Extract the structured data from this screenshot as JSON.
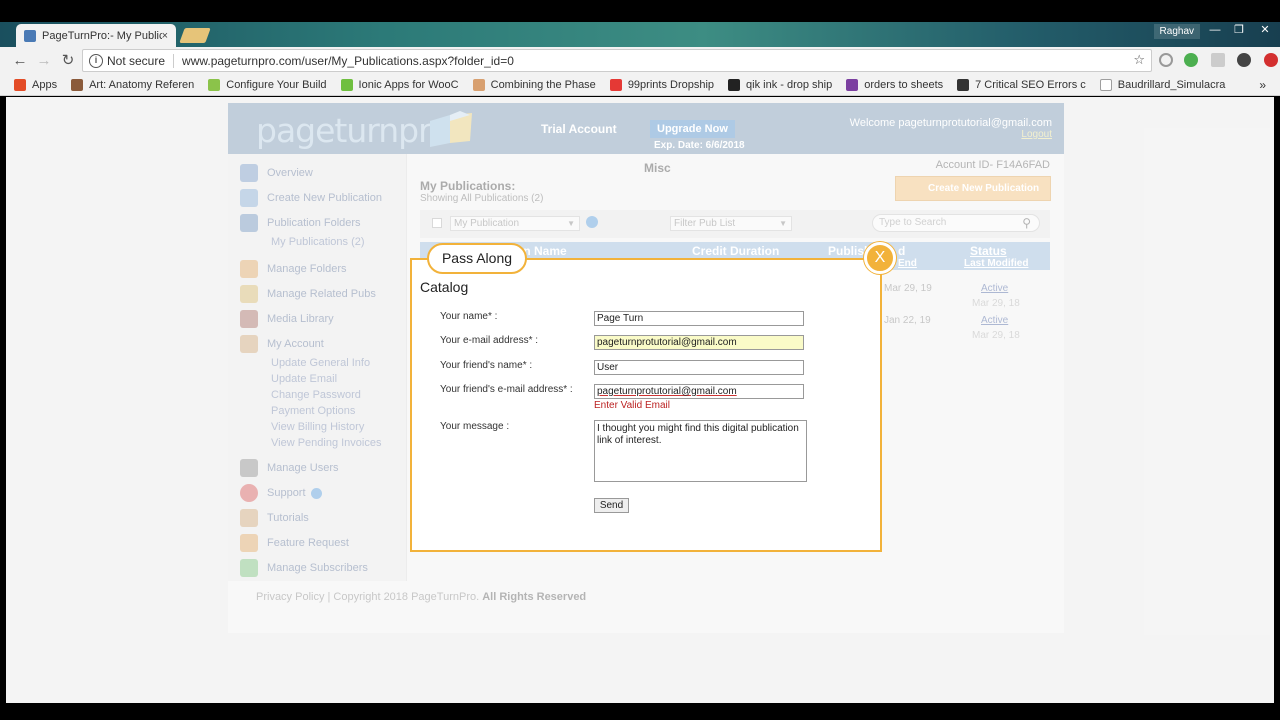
{
  "browser": {
    "tab_title": "PageTurnPro:- My Public",
    "tab_close": "×",
    "profile": "Raghav",
    "security": "Not secure",
    "url": "www.pageturnpro.com/user/My_Publications.aspx?folder_id=0",
    "bookmarks": [
      {
        "label": "Apps",
        "icon": "apps-icon",
        "color": "#e34c26"
      },
      {
        "label": "Art: Anatomy Referen",
        "icon": "figure-icon",
        "color": "#8a5a3a"
      },
      {
        "label": "Configure Your Build",
        "icon": "android-icon",
        "color": "#8bc34a"
      },
      {
        "label": "Ionic Apps for WooC",
        "icon": "ionic-icon",
        "color": "#6fbf3f"
      },
      {
        "label": "Combining the Phase",
        "icon": "person-icon",
        "color": "#d8a070"
      },
      {
        "label": "99prints Dropship",
        "icon": "gift-icon",
        "color": "#e53935"
      },
      {
        "label": "qik ink - drop ship",
        "icon": "qik-icon",
        "color": "#222222"
      },
      {
        "label": "orders to sheets",
        "icon": "woo-icon",
        "color": "#7b3fa0"
      },
      {
        "label": "7 Critical SEO Errors c",
        "icon": "chart-icon",
        "color": "#333333"
      },
      {
        "label": "Baudrillard_Simulacra",
        "icon": "doc-icon",
        "color": "#9e9e9e"
      }
    ],
    "bookmarks_more": "»"
  },
  "header": {
    "logo": "pageturnpro",
    "trial": "Trial Account",
    "upgrade": "Upgrade Now",
    "exp": "Exp. Date: 6/6/2018",
    "welcome": "Welcome pageturnprotutorial@gmail.com",
    "logout": "Logout"
  },
  "sidebar": {
    "items": [
      {
        "label": "Overview",
        "color": "#4a7ab5"
      },
      {
        "label": "Create New Publication",
        "color": "#5b8fc7"
      },
      {
        "label": "Publication Folders",
        "color": "#3d6fa8"
      },
      {
        "label": "Manage Folders",
        "color": "#d68a2e"
      },
      {
        "label": "Manage Related Pubs",
        "color": "#c9a43a"
      },
      {
        "label": "Media Library",
        "color": "#8a3b2e"
      },
      {
        "label": "My Account",
        "color": "#c08a4a"
      },
      {
        "label": "Manage Users",
        "color": "#666666"
      },
      {
        "label": "Support",
        "color": "#cc2222"
      },
      {
        "label": "Tutorials",
        "color": "#c08a4a"
      },
      {
        "label": "Feature Request",
        "color": "#d68a2e"
      },
      {
        "label": "Manage Subscribers",
        "color": "#4caf50"
      }
    ],
    "folder_sub": "My Publications (2)",
    "account_subs": [
      "Update General Info",
      "Update Email",
      "Change Password",
      "Payment Options",
      "View Billing History",
      "View Pending Invoices"
    ]
  },
  "main": {
    "misc": "Misc",
    "account_id": "Account ID- F14A6FAD",
    "title": "My Publications:",
    "showing": "Showing All Publications (2)",
    "create_btn": "Create New Publication",
    "pub_select": "My Publication",
    "filter_select": "Filter Pub List",
    "search_placeholder": "Type to Search",
    "col_name": "on Name",
    "col_credit": "Credit Duration",
    "col_publish": "Publish",
    "col_end_suffix": "d",
    "col_end": "End",
    "col_status": "Status",
    "col_last": "Last Modified",
    "rows": [
      {
        "end": "Mar 29, 19",
        "status": "Active",
        "modified": "Mar 29, 18"
      },
      {
        "end": "Jan 22, 19",
        "status": "Active",
        "modified": "Mar 29, 18"
      }
    ]
  },
  "footer": {
    "text": "Privacy Policy | Copyright 2018 PageTurnPro.",
    "bold": "All Rights Reserved"
  },
  "dialog": {
    "tab": "Pass Along",
    "close": "X",
    "title": "Catalog",
    "labels": {
      "name": "Your name* :",
      "email": "Your e-mail address* :",
      "friend_name": "Your friend's name* :",
      "friend_email": "Your friend's e-mail address* :",
      "message": "Your message :"
    },
    "values": {
      "name": "Page Turn",
      "email": "pageturnprotutorial@gmail.com",
      "friend_name": "User",
      "friend_email": "pageturnprotutorial@gmail.com",
      "message": "I thought you might find this digital publication link of interest."
    },
    "error": "Enter Valid Email",
    "send": "Send",
    "email_highlight": "#fafbc8"
  }
}
